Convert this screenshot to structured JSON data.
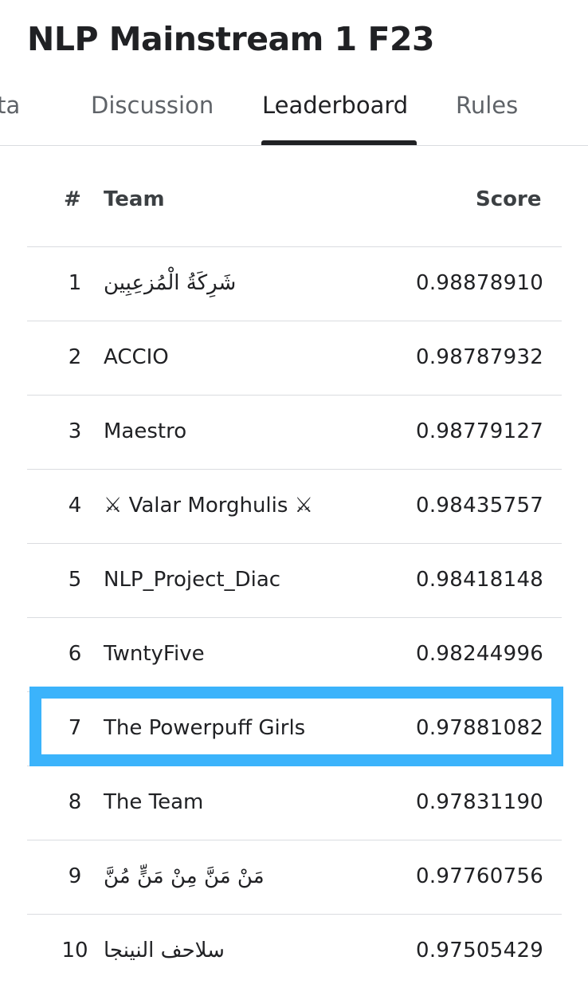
{
  "competition": {
    "title": "NLP Mainstream 1 F23"
  },
  "tabs": [
    {
      "label": "Data"
    },
    {
      "label": "Discussion"
    },
    {
      "label": "Leaderboard",
      "active": true
    },
    {
      "label": "Rules"
    }
  ],
  "leaderboard": {
    "columns": {
      "rank": "#",
      "team": "Team",
      "score": "Score"
    },
    "rows": [
      {
        "rank": "1",
        "team": "شَرِكَةُ الْمُزعِبِين",
        "score": "0.98878910"
      },
      {
        "rank": "2",
        "team": "ACCIO",
        "score": "0.98787932"
      },
      {
        "rank": "3",
        "team": "Maestro",
        "score": "0.98779127"
      },
      {
        "rank": "4",
        "team": "⚔ Valar Morghulis ⚔",
        "score": "0.98435757"
      },
      {
        "rank": "5",
        "team": "NLP_Project_Diac",
        "score": "0.98418148"
      },
      {
        "rank": "6",
        "team": "TwntyFive",
        "score": "0.98244996"
      },
      {
        "rank": "7",
        "team": "The Powerpuff Girls",
        "score": "0.97881082",
        "highlighted": true
      },
      {
        "rank": "8",
        "team": "The Team",
        "score": "0.97831190"
      },
      {
        "rank": "9",
        "team": "مَنْ مَنَّ مِنْ مَنٍّ مُنَّ",
        "score": "0.97760756"
      },
      {
        "rank": "10",
        "team": "سلاحف النينجا",
        "score": "0.97505429"
      }
    ]
  },
  "colors": {
    "highlight_border": "#3bb3fb",
    "text": "#202124",
    "divider": "#dadce0"
  }
}
